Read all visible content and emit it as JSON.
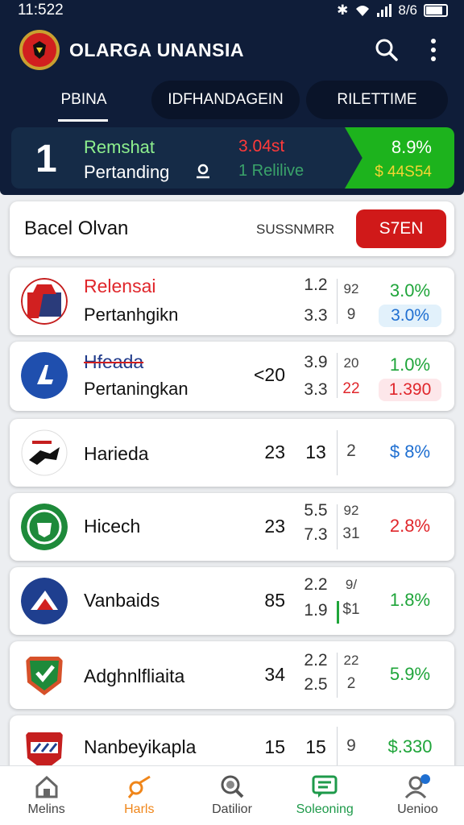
{
  "status": {
    "time": "11:522",
    "battery": "8/6"
  },
  "app": {
    "title": "OLARGA UNANSIA"
  },
  "tabs": [
    {
      "label": "PBINA"
    },
    {
      "label": "IDFHANDAGEIN"
    },
    {
      "label": "RILETTIME"
    }
  ],
  "summary": {
    "rank": "1",
    "line1": "Remshat",
    "line2": "Pertanding",
    "mid1": "3.04st",
    "mid2": "1 Relilive",
    "right1": "8.9%",
    "right2": "$ 44S54",
    "colors": {
      "up": "#1db31d",
      "down": "#ff3a3a"
    }
  },
  "filter": {
    "title": "Bacel Olvan",
    "subtitle": "SUSSNMRR",
    "button": "S7EN"
  },
  "teams": [
    {
      "name": "Relensai",
      "sub": "Pertanhgikn",
      "mid": "",
      "a1": "1.2",
      "a2": "3.3",
      "b1": "92",
      "b2": "9",
      "p1": "3.0%",
      "p2": "3.0%",
      "icon": "red-eagle-crest-icon"
    },
    {
      "name": "Hfeada",
      "sub": "Pertaningkan",
      "mid": "<20",
      "a1": "3.9",
      "a2": "3.3",
      "b1": "20",
      "b2": "22",
      "p1": "1.0%",
      "p2": "1.390",
      "icon": "blue-letter-crest-icon"
    },
    {
      "name": "Harieda",
      "sub": "",
      "mid": "23",
      "a1": "13",
      "a2": "",
      "b1": "2",
      "b2": "",
      "p1": "$ 8%",
      "p2": "",
      "icon": "black-bird-crest-icon"
    },
    {
      "name": "Hicech",
      "sub": "",
      "mid": "23",
      "a1": "5.5",
      "a2": "7.3",
      "b1": "92",
      "b2": "31",
      "p1": "2.8%",
      "p2": "",
      "icon": "green-shield-crest-icon"
    },
    {
      "name": "Vanbaids",
      "sub": "",
      "mid": "85",
      "a1": "2.2",
      "a2": "1.9",
      "b1": "9/",
      "b2": "$1",
      "p1": "1.8%",
      "p2": "",
      "icon": "blue-wing-crest-icon"
    },
    {
      "name": "Adghnlfliaita",
      "sub": "",
      "mid": "34",
      "a1": "2.2",
      "a2": "2.5",
      "b1": "22",
      "b2": "2",
      "p1": "5.9%",
      "p2": "",
      "icon": "green-check-crest-icon"
    },
    {
      "name": "Nanbeyikapla",
      "sub": "",
      "mid": "15",
      "a1": "15",
      "a2": "",
      "b1": "9",
      "b2": "",
      "p1": "$.330",
      "p2": "",
      "icon": "red-striped-crest-icon"
    }
  ],
  "nav": [
    {
      "label": "Melins",
      "icon": "home-icon"
    },
    {
      "label": "Harls",
      "icon": "whistle-icon"
    },
    {
      "label": "Datilior",
      "icon": "search-icon"
    },
    {
      "label": "Soleoning",
      "icon": "message-icon"
    },
    {
      "label": "Uenioo",
      "icon": "profile-icon"
    }
  ]
}
